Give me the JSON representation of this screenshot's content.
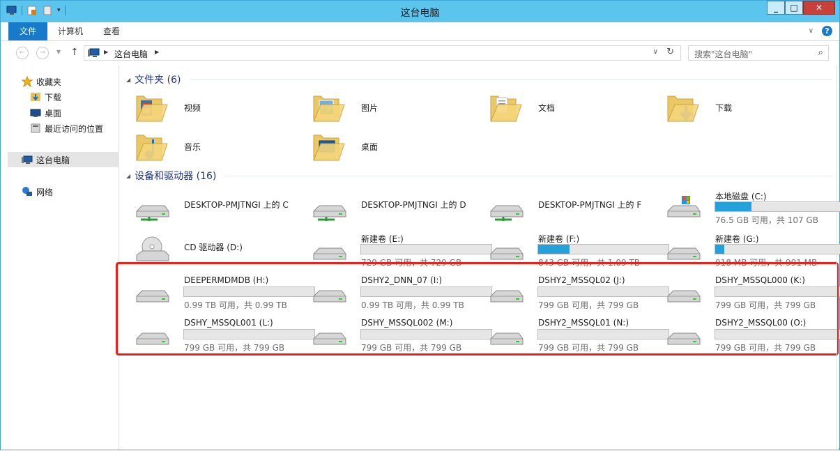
{
  "window": {
    "title": "这台电脑"
  },
  "ribbon": {
    "tabs": [
      "文件",
      "计算机",
      "查看"
    ]
  },
  "address": {
    "crumb": "这台电脑",
    "search_placeholder": "搜索\"这台电脑\""
  },
  "navpane": {
    "favorites": "收藏夹",
    "downloads": "下载",
    "desktop": "桌面",
    "recent": "最近访问的位置",
    "thispc": "这台电脑",
    "network": "网络"
  },
  "groups": {
    "folders_header": "文件夹 (6)",
    "devices_header": "设备和驱动器 (16)"
  },
  "folders": [
    {
      "name": "视频",
      "icon": "video-folder-icon"
    },
    {
      "name": "图片",
      "icon": "pictures-folder-icon"
    },
    {
      "name": "文档",
      "icon": "documents-folder-icon"
    },
    {
      "name": "下载",
      "icon": "downloads-folder-icon"
    },
    {
      "name": "音乐",
      "icon": "music-folder-icon"
    },
    {
      "name": "桌面",
      "icon": "desktop-folder-icon"
    }
  ],
  "drives": [
    {
      "name": "DESKTOP-PMJTNGI 上的 C",
      "type": "network",
      "size": "",
      "fill": 0
    },
    {
      "name": "DESKTOP-PMJTNGI 上的 D",
      "type": "network",
      "size": "",
      "fill": 0
    },
    {
      "name": "DESKTOP-PMJTNGI 上的 F",
      "type": "network",
      "size": "",
      "fill": 0
    },
    {
      "name": "本地磁盘 (C:)",
      "type": "system",
      "size": "76.5 GB 可用，共 107 GB",
      "fill": 0.28
    },
    {
      "name": "CD 驱动器 (D:)",
      "type": "cd",
      "size": "",
      "fill": 0
    },
    {
      "name": "新建卷 (E:)",
      "type": "disk",
      "size": "729 GB 可用，共 729 GB",
      "fill": 0.0
    },
    {
      "name": "新建卷 (F:)",
      "type": "disk",
      "size": "843 GB 可用，共 1.09 TB",
      "fill": 0.24
    },
    {
      "name": "新建卷 (G:)",
      "type": "disk",
      "size": "918 MB 可用，共 991 MB",
      "fill": 0.07
    },
    {
      "name": "DEEPERMDMDB (H:)",
      "type": "disk",
      "size": "0.99 TB 可用，共 0.99 TB",
      "fill": 0
    },
    {
      "name": "DSHY2_DNN_07 (I:)",
      "type": "disk",
      "size": "0.99 TB 可用，共 0.99 TB",
      "fill": 0
    },
    {
      "name": "DSHY2_MSSQL02 (J:)",
      "type": "disk",
      "size": "799 GB 可用，共 799 GB",
      "fill": 0
    },
    {
      "name": "DSHY_MSSQL000 (K:)",
      "type": "disk",
      "size": "799 GB 可用，共 799 GB",
      "fill": 0
    },
    {
      "name": "DSHY_MSSQL001 (L:)",
      "type": "disk",
      "size": "799 GB 可用，共 799 GB",
      "fill": 0
    },
    {
      "name": "DSHY_MSSQL002 (M:)",
      "type": "disk",
      "size": "799 GB 可用，共 799 GB",
      "fill": 0
    },
    {
      "name": "DSHY2_MSSQL01 (N:)",
      "type": "disk",
      "size": "799 GB 可用，共 799 GB",
      "fill": 0
    },
    {
      "name": "DSHY2_MSSQL00 (O:)",
      "type": "disk",
      "size": "799 GB 可用，共 799 GB",
      "fill": 0
    }
  ],
  "colors": {
    "titlebar": "#5cc5ee",
    "file_tab": "#1979ca",
    "bar_fill": "#26a0da",
    "highlight_box": "#e8221a"
  }
}
